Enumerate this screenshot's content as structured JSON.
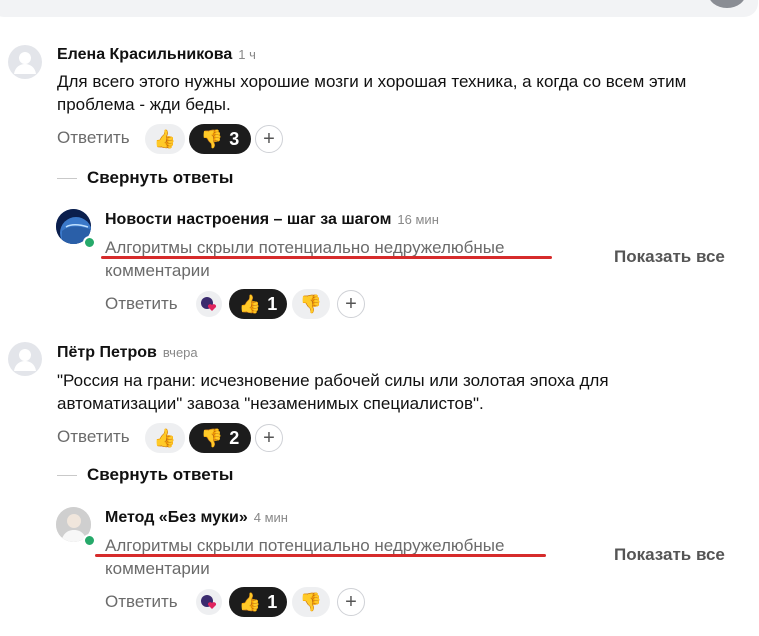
{
  "comments": [
    {
      "author": "Елена Красильникова",
      "time": "1 ч",
      "text": "Для всего этого нужны хорошие мозги и хорошая техника, а когда со всем этим проблема - жди беды.",
      "reply_label": "Ответить",
      "dislike_count": "3",
      "collapse_label": "Свернуть ответы",
      "reply": {
        "author": "Новости настроения – шаг за шагом",
        "time": "16 мин",
        "hidden_text": "Алгоритмы скрыли потенциально недружелюбные комментарии",
        "show_all": "Показать все",
        "reply_label": "Ответить",
        "like_count": "1"
      }
    },
    {
      "author": "Пётр Петров",
      "time": "вчера",
      "text": "\"Россия на грани: исчезновение рабочей силы или золотая эпоха для автоматизации\" завоза \"незаменимых специалистов\".",
      "reply_label": "Ответить",
      "dislike_count": "2",
      "collapse_label": "Свернуть ответы",
      "reply": {
        "author": "Метод «Без муки»",
        "time": "4 мин",
        "hidden_text": "Алгоритмы скрыли потенциально недружелюбные комментарии",
        "show_all": "Показать все",
        "reply_label": "Ответить",
        "like_count": "1"
      }
    }
  ],
  "icons": {
    "like": "thumbs-up-icon",
    "dislike": "thumbs-down-icon",
    "add_reaction": "plus-icon",
    "avatar_placeholder": "user-icon",
    "reaction_avatar": "heart-reaction-icon"
  },
  "colors": {
    "accent_red": "#d62b2b",
    "online": "#26a96a",
    "dark_pill": "#1c1c1c",
    "light_pill": "#eeeff1",
    "like_icon": "#f5a623"
  }
}
